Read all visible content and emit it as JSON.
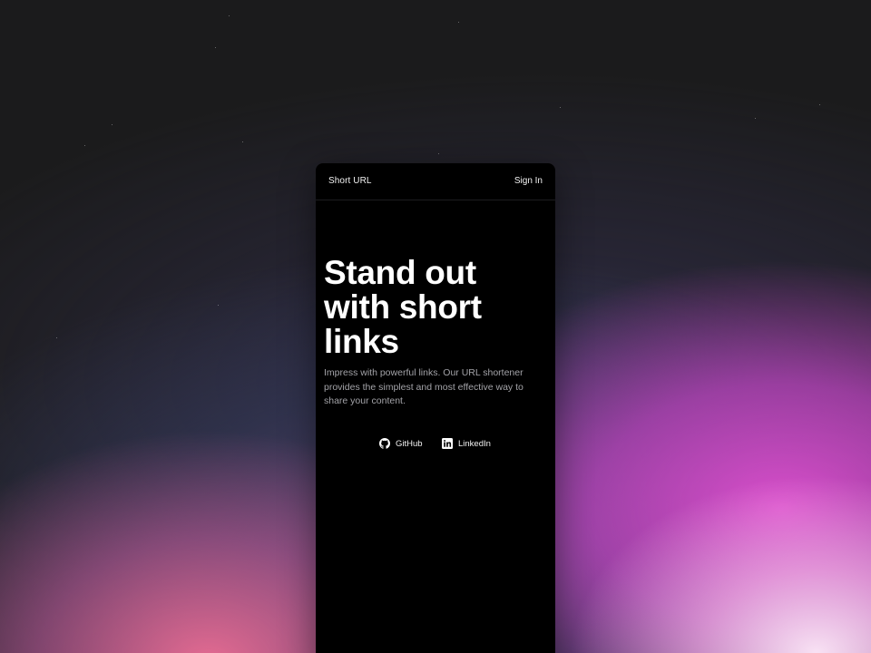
{
  "header": {
    "brand": "Short URL",
    "signin_label": "Sign In"
  },
  "hero": {
    "title_lines": [
      "Stand out",
      "with short",
      "links"
    ],
    "description": "Impress with powerful links. Our URL shortener provides the simplest and most effective way to share your content."
  },
  "social_links": [
    {
      "label": "GitHub",
      "icon": "github-icon"
    },
    {
      "label": "LinkedIn",
      "icon": "linkedin-icon"
    }
  ],
  "colors": {
    "page_background": "#1b1b1c",
    "card_background": "#000000",
    "text_primary": "#ffffff",
    "text_secondary": "#a3a3a8",
    "gradient_pink": "#e050d2",
    "gradient_rose": "#ee6e96"
  }
}
